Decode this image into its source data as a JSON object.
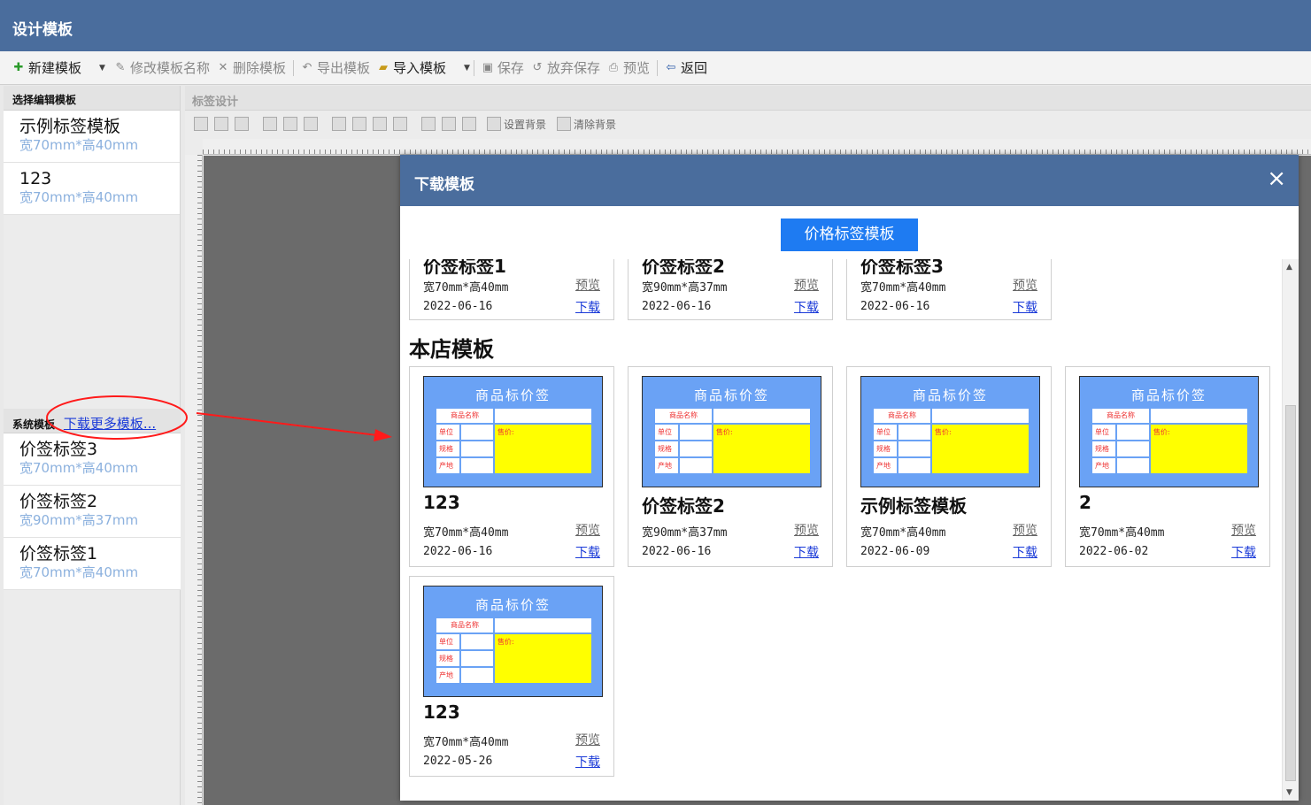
{
  "window": {
    "title": "设计模板"
  },
  "toolbar": {
    "new_template": "新建模板",
    "rename_template": "修改模板名称",
    "delete_template": "删除模板",
    "export_template": "导出模板",
    "import_template": "导入模板",
    "save": "保存",
    "discard_save": "放弃保存",
    "preview": "预览",
    "back": "返回"
  },
  "left_panel": {
    "header": "选择编辑模板",
    "items": [
      {
        "name": "示例标签模板",
        "size": "宽70mm*高40mm"
      },
      {
        "name": "123",
        "size": "宽70mm*高40mm"
      }
    ],
    "system_header": "系统模板",
    "download_more": "下载更多模板...",
    "system_items": [
      {
        "name": "价签标签3",
        "size": "宽70mm*高40mm"
      },
      {
        "name": "价签标签2",
        "size": "宽90mm*高37mm"
      },
      {
        "name": "价签标签1",
        "size": "宽70mm*高40mm"
      }
    ]
  },
  "design": {
    "header": "标签设计",
    "set_background": "设置背景",
    "clear_background": "清除背景"
  },
  "modal": {
    "title": "下载模板",
    "close": "×",
    "tab": "价格标签模板",
    "top_row": [
      {
        "name": "价签标签1",
        "size": "宽70mm*高40mm",
        "date": "2022-06-16",
        "preview": "预览",
        "download": "下载"
      },
      {
        "name": "价签标签2",
        "size": "宽90mm*高37mm",
        "date": "2022-06-16",
        "preview": "预览",
        "download": "下载"
      },
      {
        "name": "价签标签3",
        "size": "宽70mm*高40mm",
        "date": "2022-06-16",
        "preview": "预览",
        "download": "下载"
      }
    ],
    "section_title": "本店模板",
    "thumb": {
      "title": "商品标价签",
      "name_label": "商品名称",
      "unit": "单位",
      "spec": "规格",
      "origin": "产地",
      "price": "售价:"
    },
    "store_cards": [
      {
        "name": "123",
        "size": "宽70mm*高40mm",
        "date": "2022-06-16",
        "preview": "预览",
        "download": "下载"
      },
      {
        "name": "价签标签2",
        "size": "宽90mm*高37mm",
        "date": "2022-06-16",
        "preview": "预览",
        "download": "下载"
      },
      {
        "name": "示例标签模板",
        "size": "宽70mm*高40mm",
        "date": "2022-06-09",
        "preview": "预览",
        "download": "下载"
      },
      {
        "name": "2",
        "size": "宽70mm*高40mm",
        "date": "2022-06-02",
        "preview": "预览",
        "download": "下载"
      },
      {
        "name": "123",
        "size": "宽70mm*高40mm",
        "date": "2022-05-26",
        "preview": "预览",
        "download": "下载"
      }
    ]
  },
  "colors": {
    "header_blue": "#4a6d9d",
    "tab_blue": "#1e7bf2",
    "thumb_blue": "#6aa2f5",
    "price_yellow": "#ffff00",
    "annotation_red": "#ff1a1a"
  }
}
